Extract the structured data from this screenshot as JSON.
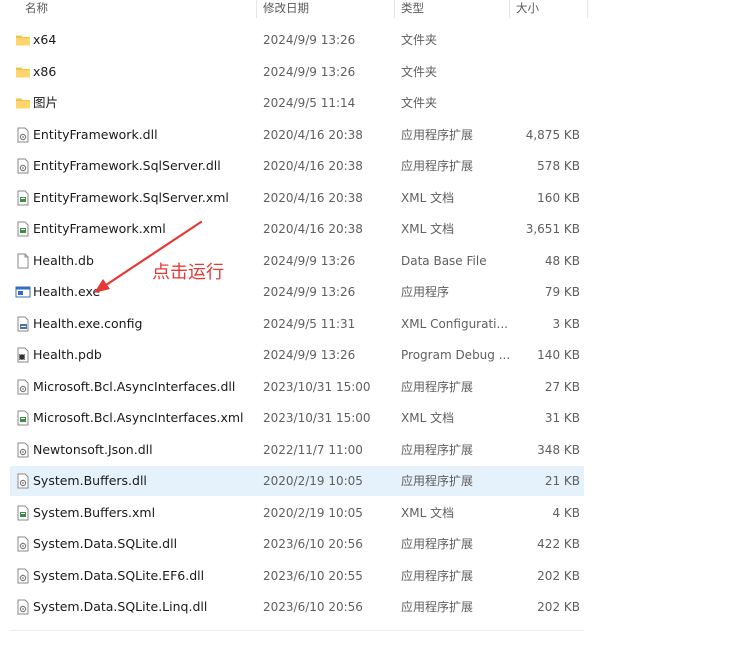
{
  "header": {
    "name": "名称",
    "date": "修改日期",
    "type": "类型",
    "size": "大小"
  },
  "files": [
    {
      "name": "x64",
      "date": "2024/9/9 13:26",
      "type": "文件夹",
      "size": "",
      "icon": "folder-icon"
    },
    {
      "name": "x86",
      "date": "2024/9/9 13:26",
      "type": "文件夹",
      "size": "",
      "icon": "folder-icon"
    },
    {
      "name": "图片",
      "date": "2024/9/5 11:14",
      "type": "文件夹",
      "size": "",
      "icon": "folder-icon"
    },
    {
      "name": "EntityFramework.dll",
      "date": "2020/4/16 20:38",
      "type": "应用程序扩展",
      "size": "4,875 KB",
      "icon": "dll-icon"
    },
    {
      "name": "EntityFramework.SqlServer.dll",
      "date": "2020/4/16 20:38",
      "type": "应用程序扩展",
      "size": "578 KB",
      "icon": "dll-icon"
    },
    {
      "name": "EntityFramework.SqlServer.xml",
      "date": "2020/4/16 20:38",
      "type": "XML 文档",
      "size": "160 KB",
      "icon": "xml-icon"
    },
    {
      "name": "EntityFramework.xml",
      "date": "2020/4/16 20:38",
      "type": "XML 文档",
      "size": "3,651 KB",
      "icon": "xml-icon"
    },
    {
      "name": "Health.db",
      "date": "2024/9/9 13:26",
      "type": "Data Base File",
      "size": "48 KB",
      "icon": "file-icon"
    },
    {
      "name": "Health.exe",
      "date": "2024/9/9 13:26",
      "type": "应用程序",
      "size": "79 KB",
      "icon": "exe-icon"
    },
    {
      "name": "Health.exe.config",
      "date": "2024/9/5 11:31",
      "type": "XML Configurati...",
      "size": "3 KB",
      "icon": "config-icon"
    },
    {
      "name": "Health.pdb",
      "date": "2024/9/9 13:26",
      "type": "Program Debug ...",
      "size": "140 KB",
      "icon": "pdb-icon"
    },
    {
      "name": "Microsoft.Bcl.AsyncInterfaces.dll",
      "date": "2023/10/31 15:00",
      "type": "应用程序扩展",
      "size": "27 KB",
      "icon": "dll-icon"
    },
    {
      "name": "Microsoft.Bcl.AsyncInterfaces.xml",
      "date": "2023/10/31 15:00",
      "type": "XML 文档",
      "size": "31 KB",
      "icon": "xml-icon"
    },
    {
      "name": "Newtonsoft.Json.dll",
      "date": "2022/11/7 11:00",
      "type": "应用程序扩展",
      "size": "348 KB",
      "icon": "dll-icon"
    },
    {
      "name": "System.Buffers.dll",
      "date": "2020/2/19 10:05",
      "type": "应用程序扩展",
      "size": "21 KB",
      "icon": "dll-icon"
    },
    {
      "name": "System.Buffers.xml",
      "date": "2020/2/19 10:05",
      "type": "XML 文档",
      "size": "4 KB",
      "icon": "xml-icon"
    },
    {
      "name": "System.Data.SQLite.dll",
      "date": "2023/6/10 20:56",
      "type": "应用程序扩展",
      "size": "422 KB",
      "icon": "dll-icon"
    },
    {
      "name": "System.Data.SQLite.EF6.dll",
      "date": "2023/6/10 20:55",
      "type": "应用程序扩展",
      "size": "202 KB",
      "icon": "dll-icon"
    },
    {
      "name": "System.Data.SQLite.Linq.dll",
      "date": "2023/6/10 20:56",
      "type": "应用程序扩展",
      "size": "202 KB",
      "icon": "dll-icon"
    }
  ],
  "annotation": {
    "text": "点击运行",
    "color": "#e53935"
  },
  "colors": {
    "selected_row": "#e5f1fb",
    "folder": "#f2c14e",
    "accent": "#1a6fc4"
  }
}
